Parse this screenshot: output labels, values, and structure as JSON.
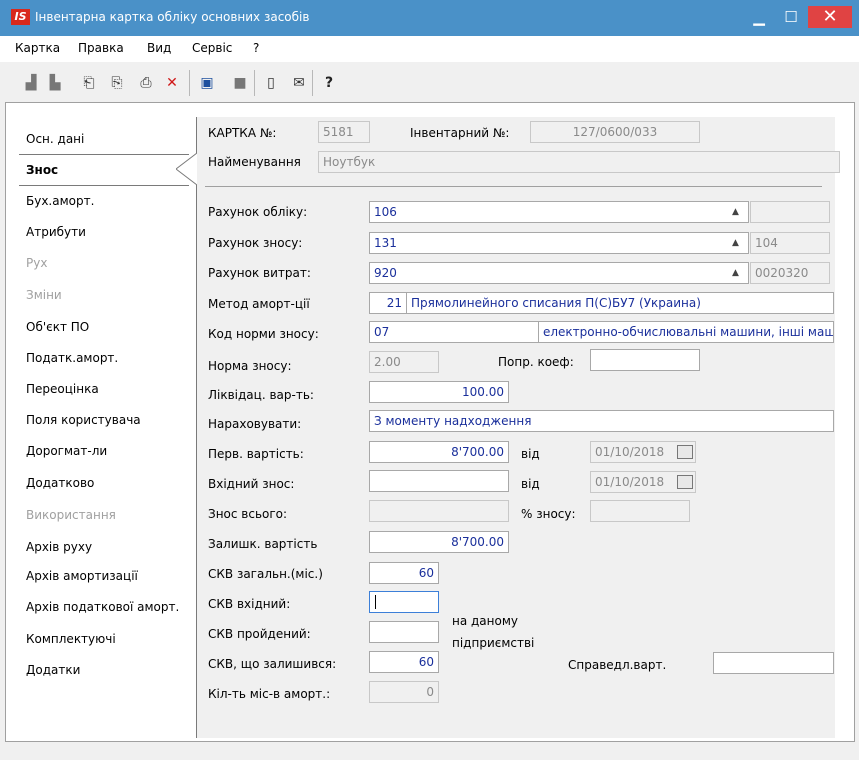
{
  "window": {
    "title": "Інвентарна картка обліку основних засобів",
    "app_icon": "IS"
  },
  "menu": [
    "Картка",
    "Правка",
    "Вид",
    "Сервіс",
    "?"
  ],
  "sidebar": [
    {
      "label": "Осн. дані",
      "enabled": true
    },
    {
      "label": "Знос",
      "enabled": true,
      "active": true
    },
    {
      "label": "Бух.аморт.",
      "enabled": true
    },
    {
      "label": "Атрибути",
      "enabled": true
    },
    {
      "label": "Рух",
      "enabled": false
    },
    {
      "label": "Зміни",
      "enabled": false
    },
    {
      "label": "Об'єкт ПО",
      "enabled": true
    },
    {
      "label": "Податк.аморт.",
      "enabled": true
    },
    {
      "label": "Переоцінка",
      "enabled": true
    },
    {
      "label": "Поля користувача",
      "enabled": true
    },
    {
      "label": "Дорогмат-ли",
      "enabled": true
    },
    {
      "label": "Додатково",
      "enabled": true
    },
    {
      "label": "Використання",
      "enabled": false
    },
    {
      "label": "Архів руху",
      "enabled": true
    },
    {
      "label": "Архів амортизації",
      "enabled": true
    },
    {
      "label": "Архів податкової аморт.",
      "enabled": true
    },
    {
      "label": "Комплектуючі",
      "enabled": true
    },
    {
      "label": "Додатки",
      "enabled": true
    }
  ],
  "header": {
    "card_label": "КАРТКА №:",
    "card_no": "5181",
    "inv_label": "Інвентарний №:",
    "inv_no": "127/0600/033",
    "name_label": "Найменування",
    "name": "Ноутбук"
  },
  "form": {
    "account_label": "Рахунок обліку:",
    "account": "106",
    "account_extra": "",
    "depr_account_label": "Рахунок зносу:",
    "depr_account": "131",
    "depr_account_extra": "104",
    "cost_account_label": "Рахунок витрат:",
    "cost_account": "920",
    "cost_account_extra": "0020320",
    "method_label": "Метод аморт-ції",
    "method_code": "21",
    "method_name": "Прямолинейного списания П(С)БУ7 (Украина)",
    "norm_code_label": "Код норми зносу:",
    "norm_code": "07",
    "norm_code_name": "електронно-обчислювальні машини, інші машини",
    "norm_label": "Норма зносу:",
    "norm": "2.00",
    "coef_label": "Попр. коеф:",
    "coef": "",
    "liquid_label": "Ліквідац. вар-ть:",
    "liquid": "100.00",
    "accrue_label": "Нараховувати:",
    "accrue": "З моменту надходження",
    "initial_cost_label": "Перв. вартість:",
    "initial_cost": "8'700.00",
    "from_label": "від",
    "initial_date": "01/10/2018",
    "input_depr_label": "Вхідний знос:",
    "input_depr": "",
    "from_label2": "від",
    "input_date": "01/10/2018",
    "total_depr_label": "Знос всього:",
    "total_depr": "",
    "pct_label": "% зносу:",
    "pct": "",
    "residual_label": "Залишк. вартість",
    "residual": "8'700.00",
    "useful_total_label": "СКВ загальн.(міс.)",
    "useful_total": "60",
    "useful_input_label": "СКВ вхідний:",
    "useful_input": "",
    "useful_passed_label": "СКВ пройдений:",
    "useful_passed": "",
    "at_enterprise_label1": "на даному",
    "at_enterprise_label2": "підприємстві",
    "useful_left_label": "СКВ, що залишився:",
    "useful_left": "60",
    "fair_value_label": "Справедл.варт.",
    "fair_value": "",
    "months_label": "Кіл-ть міс-в аморт.:",
    "months": "0"
  },
  "colors": {
    "titlebar": "#4a91c8",
    "close": "#e04343",
    "value_text": "#1a2f9b"
  }
}
